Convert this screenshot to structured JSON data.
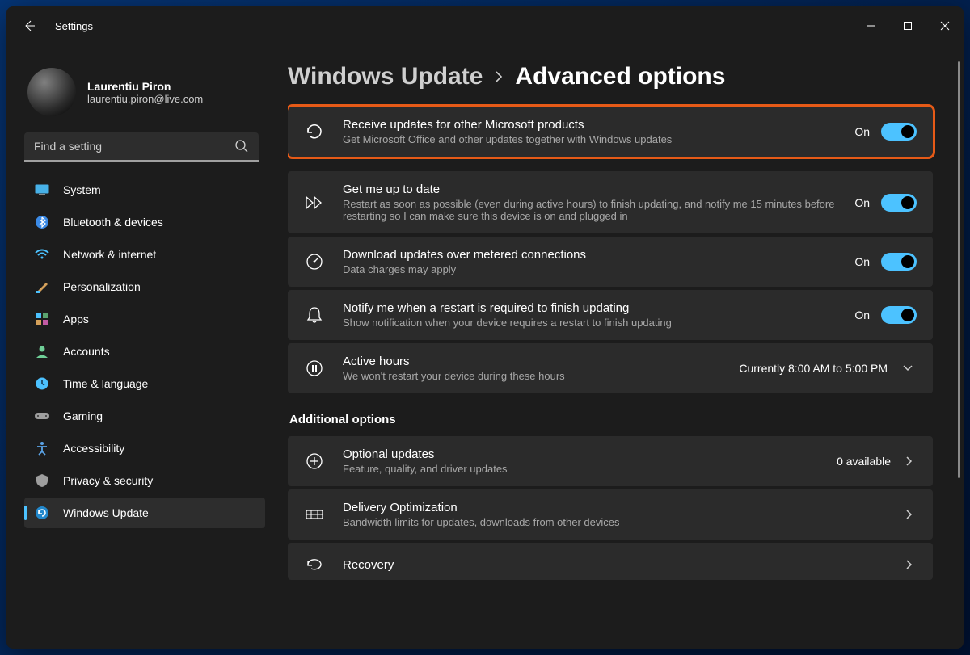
{
  "app_title": "Settings",
  "profile": {
    "name": "Laurentiu Piron",
    "email": "laurentiu.piron@live.com"
  },
  "search": {
    "placeholder": "Find a setting"
  },
  "nav": [
    {
      "label": "System"
    },
    {
      "label": "Bluetooth & devices"
    },
    {
      "label": "Network & internet"
    },
    {
      "label": "Personalization"
    },
    {
      "label": "Apps"
    },
    {
      "label": "Accounts"
    },
    {
      "label": "Time & language"
    },
    {
      "label": "Gaming"
    },
    {
      "label": "Accessibility"
    },
    {
      "label": "Privacy & security"
    },
    {
      "label": "Windows Update"
    }
  ],
  "breadcrumb": {
    "parent": "Windows Update",
    "current": "Advanced options"
  },
  "settings": [
    {
      "title": "Receive updates for other Microsoft products",
      "sub": "Get Microsoft Office and other updates together with Windows updates",
      "state": "On"
    },
    {
      "title": "Get me up to date",
      "sub": "Restart as soon as possible (even during active hours) to finish updating, and notify me 15 minutes before restarting so I can make sure this device is on and plugged in",
      "state": "On"
    },
    {
      "title": "Download updates over metered connections",
      "sub": "Data charges may apply",
      "state": "On"
    },
    {
      "title": "Notify me when a restart is required to finish updating",
      "sub": "Show notification when your device requires a restart to finish updating",
      "state": "On"
    }
  ],
  "active_hours": {
    "title": "Active hours",
    "sub": "We won't restart your device during these hours",
    "value": "Currently 8:00 AM to 5:00 PM"
  },
  "section_head": "Additional options",
  "additional": [
    {
      "title": "Optional updates",
      "sub": "Feature, quality, and driver updates",
      "value": "0 available"
    },
    {
      "title": "Delivery Optimization",
      "sub": "Bandwidth limits for updates, downloads from other devices",
      "value": ""
    },
    {
      "title": "Recovery",
      "sub": "",
      "value": ""
    }
  ]
}
